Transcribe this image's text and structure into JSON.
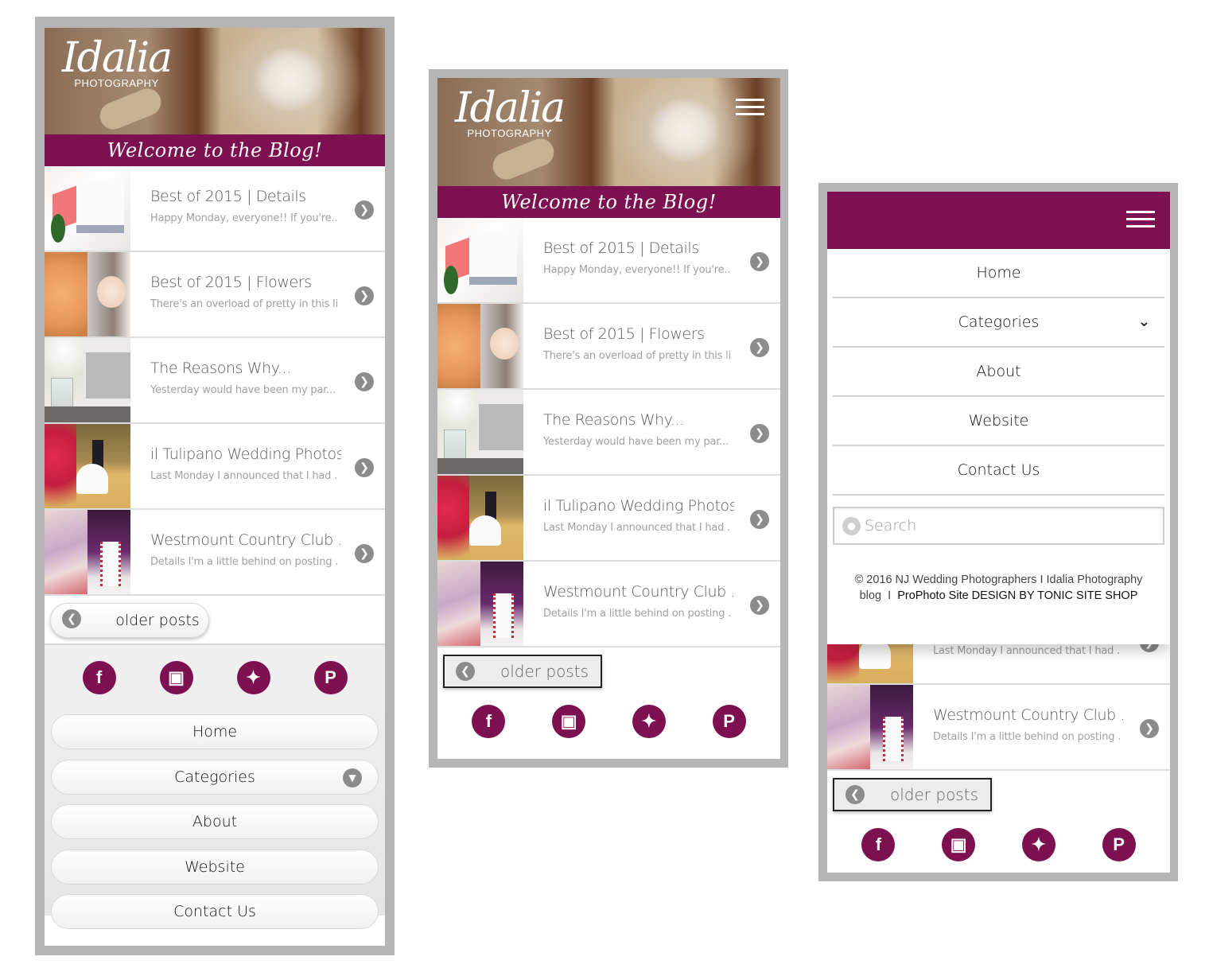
{
  "brand": {
    "logo_script": "Idalia",
    "logo_sub": "PHOTOGRAPHY",
    "welcome": "Welcome to the Blog!",
    "accent_color": "#7c1050"
  },
  "posts": [
    {
      "title": "Best of 2015 | Details",
      "excerpt": "Happy Monday, everyone!! If you're.."
    },
    {
      "title": "Best of 2015 | Flowers",
      "excerpt": "There's an overload of pretty in this li.."
    },
    {
      "title": "The Reasons Why...",
      "excerpt": "Yesterday would have been my par..."
    },
    {
      "title": "il Tulipano Wedding Photos c",
      "excerpt": "Last Monday I announced that I had ..."
    },
    {
      "title": "Westmount Country Club ...",
      "excerpt": "Details I'm a little behind on posting ..."
    }
  ],
  "pagination": {
    "older_label": "older posts"
  },
  "social": [
    {
      "name": "facebook",
      "glyph": "f"
    },
    {
      "name": "instagram",
      "glyph": "◙"
    },
    {
      "name": "twitter",
      "glyph": "🐦"
    },
    {
      "name": "pinterest",
      "glyph": "P"
    }
  ],
  "menu": {
    "items": [
      "Home",
      "Categories",
      "About",
      "Website",
      "Contact Us"
    ],
    "search_placeholder": "Search"
  },
  "footer": {
    "copyright": "© 2016 NJ Wedding Photographers I Idalia Photography blog",
    "separator": "I",
    "credit": "ProPhoto Site DESIGN BY TONIC SITE SHOP"
  },
  "icons": {
    "arrow_right": "›",
    "arrow_left": "‹",
    "chevron_down": "⌄",
    "chevron_bold": "❯",
    "search": "⚲"
  }
}
